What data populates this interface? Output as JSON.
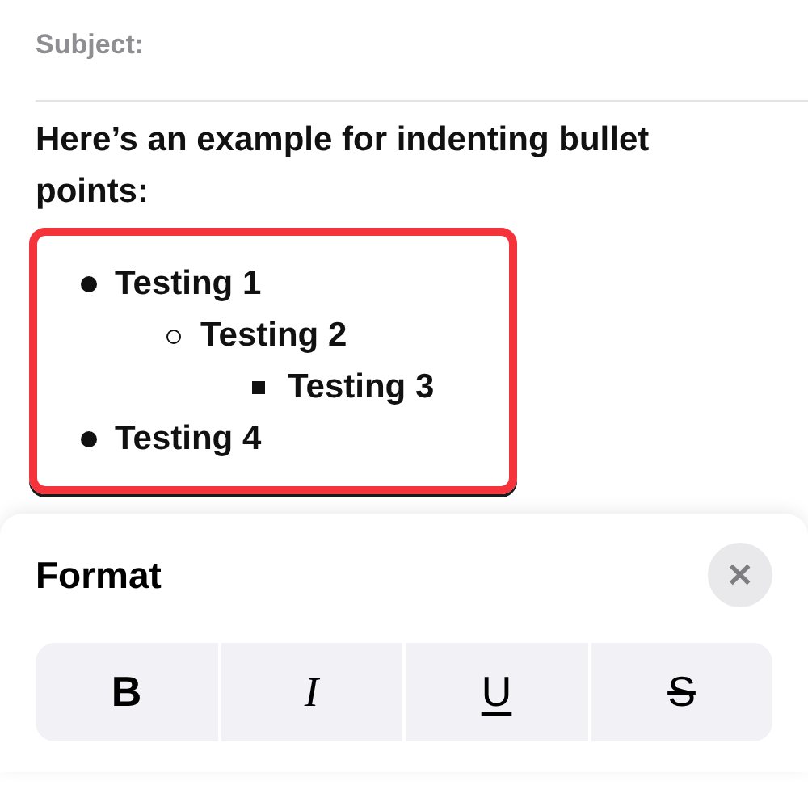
{
  "compose": {
    "subject_label": "Subject:",
    "body_text": "Here’s an example for indenting bullet points:",
    "bullets": [
      {
        "text": "Testing 1",
        "children": [
          {
            "text": "Testing 2",
            "children": [
              {
                "text": "Testing 3"
              }
            ]
          }
        ]
      },
      {
        "text": "Testing 4"
      }
    ]
  },
  "format_sheet": {
    "title": "Format",
    "close": "✕",
    "style_buttons": [
      {
        "label": "B",
        "kind": "bold"
      },
      {
        "label": "I",
        "kind": "italic"
      },
      {
        "label": "U",
        "kind": "underline"
      },
      {
        "label": "S",
        "kind": "strikethrough"
      }
    ]
  }
}
